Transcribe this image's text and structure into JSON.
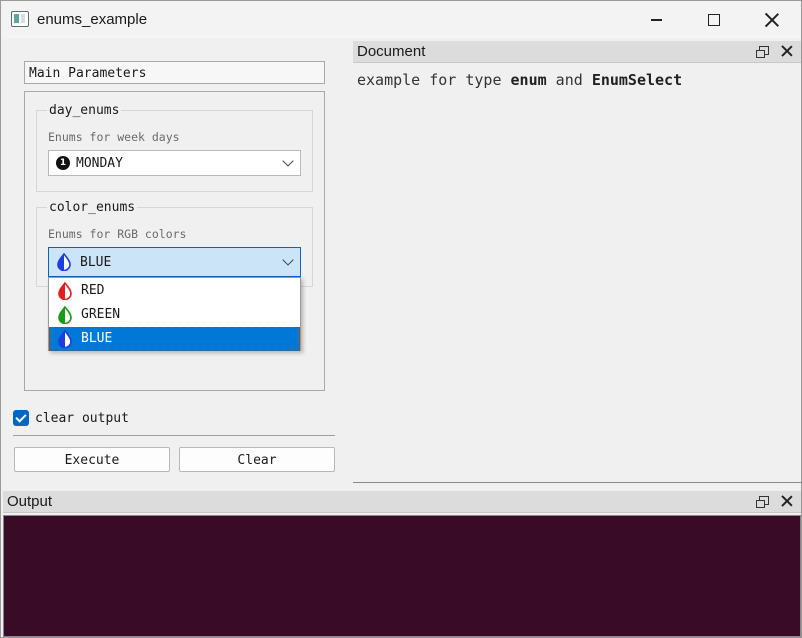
{
  "window": {
    "title": "enums_example"
  },
  "left_panel": {
    "section_header": "Main Parameters",
    "day_enums": {
      "title": "day_enums",
      "description": "Enums for week days",
      "selected": "MONDAY",
      "selected_icon": "number-one-circle-icon"
    },
    "color_enums": {
      "title": "color_enums",
      "description": "Enums for RGB colors",
      "selected": "BLUE",
      "options": [
        {
          "label": "RED",
          "color": "#e02020"
        },
        {
          "label": "GREEN",
          "color": "#1a9a1a"
        },
        {
          "label": "BLUE",
          "color": "#1a3fe0"
        }
      ]
    },
    "clear_output": {
      "label": "clear output",
      "checked": true
    },
    "execute_label": "Execute",
    "clear_label": "Clear"
  },
  "document": {
    "title": "Document",
    "text": {
      "p1": "example for type ",
      "b1": "enum",
      "p2": " and ",
      "b2": "EnumSelect"
    }
  },
  "output": {
    "title": "Output"
  },
  "colors": {
    "accent": "#0078d7",
    "output_bg": "#3a0b27"
  }
}
